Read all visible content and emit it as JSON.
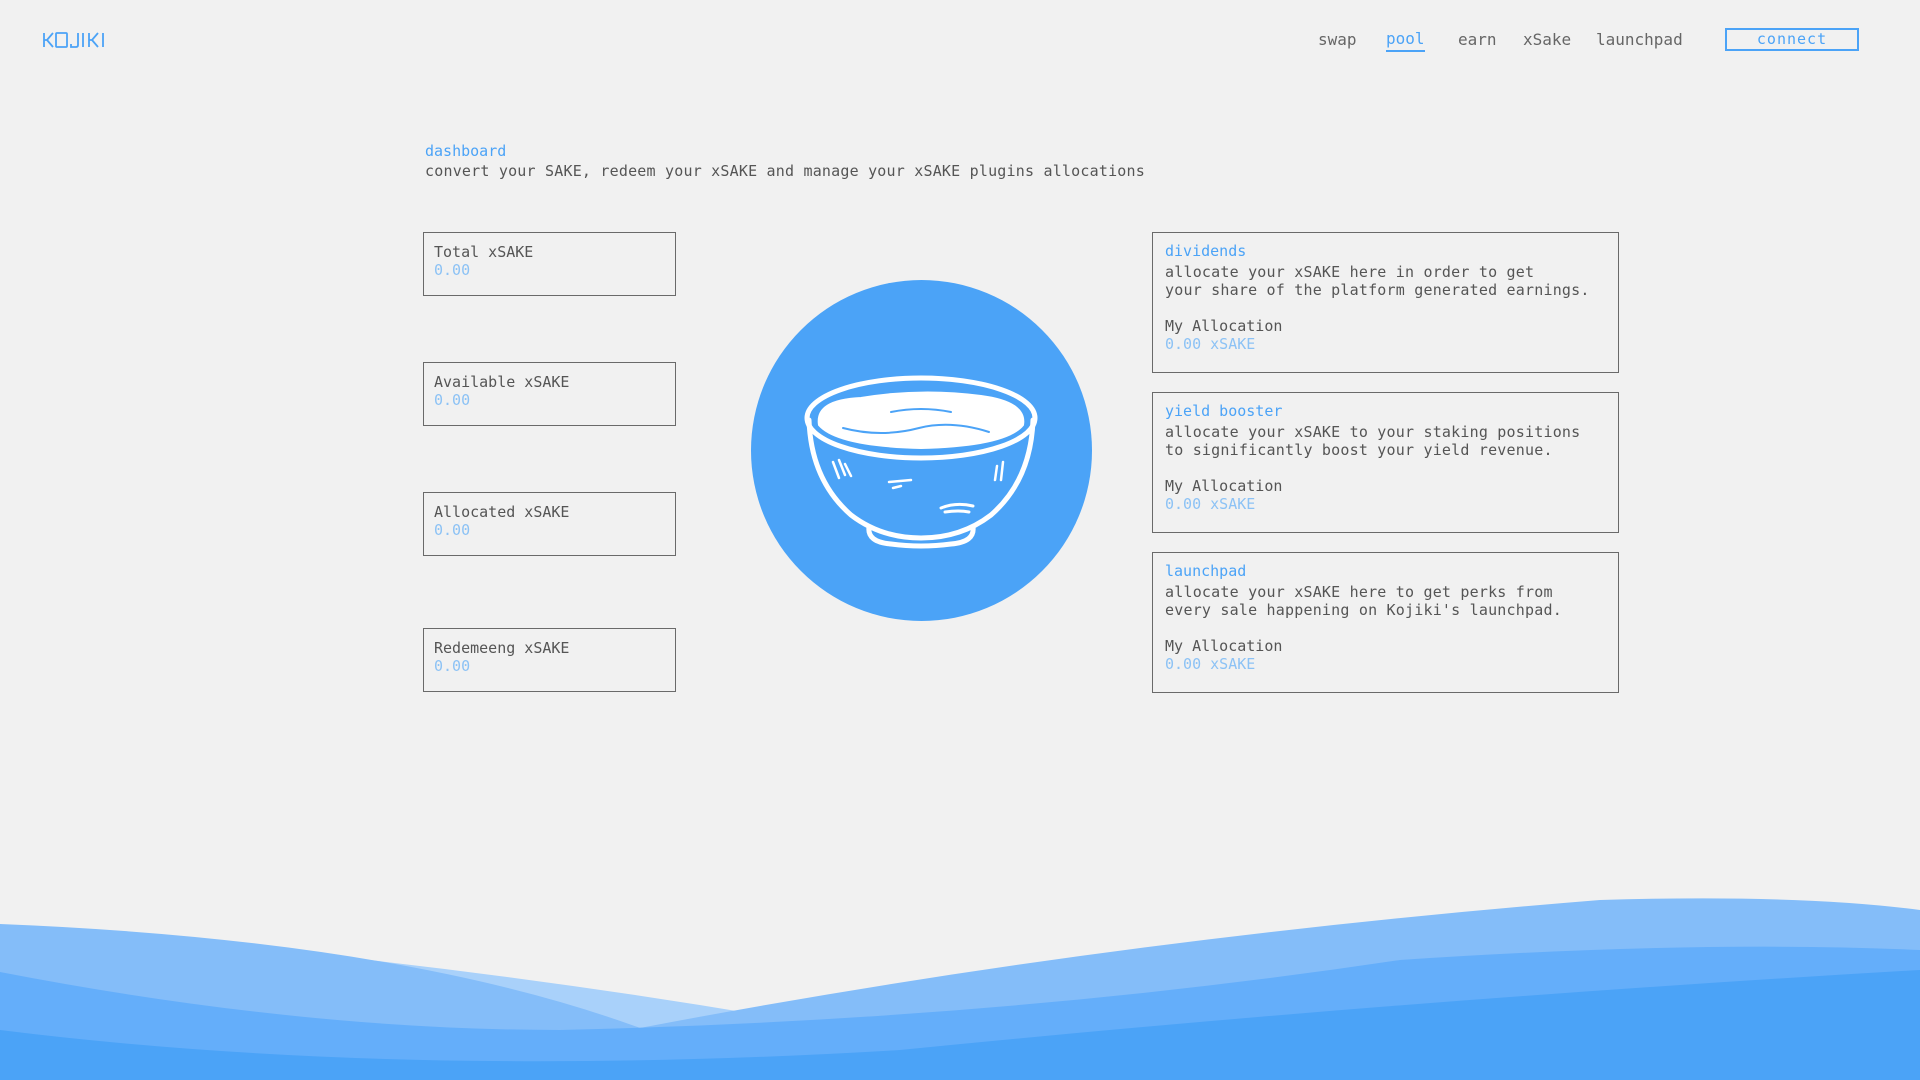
{
  "brand": {
    "logo_text": "KOJIKI"
  },
  "nav": {
    "items": [
      {
        "label": "swap",
        "active": false
      },
      {
        "label": "pool",
        "active": true
      },
      {
        "label": "earn",
        "active": false
      },
      {
        "label": "xSake",
        "active": false
      },
      {
        "label": "launchpad",
        "active": false
      }
    ],
    "connect_label": "connect"
  },
  "header": {
    "title": "dashboard",
    "subtitle": "convert your SAKE, redeem your xSAKE and manage your xSAKE plugins allocations"
  },
  "stats": [
    {
      "label": "Total xSAKE",
      "value": "0.00"
    },
    {
      "label": "Available xSAKE",
      "value": "0.00"
    },
    {
      "label": "Allocated xSAKE",
      "value": "0.00"
    },
    {
      "label": "Redemeeng xSAKE",
      "value": "0.00"
    }
  ],
  "center": {
    "icon": "sake-bowl-icon"
  },
  "plugins": [
    {
      "title": "dividends",
      "desc_line1": "allocate your xSAKE here in order to get",
      "desc_line2": "your share of the platform generated earnings.",
      "alloc_label": "My Allocation",
      "alloc_value": "0.00 xSAKE"
    },
    {
      "title": "yield booster",
      "desc_line1": "allocate your xSAKE to your staking positions",
      "desc_line2": "to significantly boost your yield revenue.",
      "alloc_label": "My Allocation",
      "alloc_value": "0.00 xSAKE"
    },
    {
      "title": "launchpad",
      "desc_line1": "allocate your xSAKE here to get perks from",
      "desc_line2": "every sale happening on Kojiki's launchpad.",
      "alloc_label": "My Allocation",
      "alloc_value": "0.00 xSAKE"
    }
  ],
  "colors": {
    "accent": "#4ba3f7",
    "accent_light": "#8cc2f5",
    "background": "#f1f1f1",
    "text": "#555555"
  }
}
